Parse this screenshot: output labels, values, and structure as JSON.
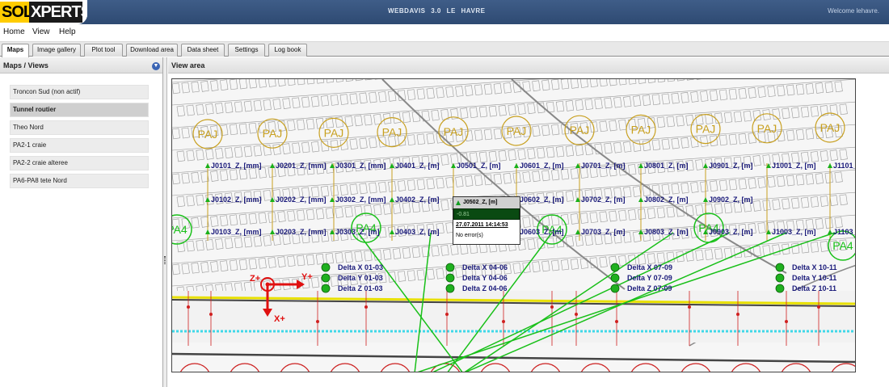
{
  "header": {
    "logo_left": "SOLE",
    "logo_right": "XPERTS",
    "app_title": "WEBDAVIS 3.0 LE HAVRE",
    "welcome": "Welcome lehavre."
  },
  "menu": [
    "Home",
    "View",
    "Help"
  ],
  "tabs": [
    "Maps",
    "Image gallery",
    "Plot tool",
    "Download area",
    "Data sheet",
    "Settings",
    "Log book"
  ],
  "active_tab": "Maps",
  "left_panel": {
    "title": "Maps / Views",
    "items": [
      {
        "label": "Troncon Sud (non actif)",
        "selected": false
      },
      {
        "label": "Tunnel routier",
        "selected": true
      },
      {
        "label": "Theo Nord",
        "selected": false
      },
      {
        "label": "PA2-1 craie",
        "selected": false
      },
      {
        "label": "PA2-2 craie alteree",
        "selected": false
      },
      {
        "label": "PA6-PA8 tete Nord",
        "selected": false
      }
    ]
  },
  "view_area": {
    "title": "View area",
    "pa_markers": [
      "PAJ",
      "PAJ",
      "PAJ",
      "PAJ",
      "PAJ",
      "PAJ",
      "PAJ",
      "PAJ",
      "PAJ",
      "PAJ",
      "PAJ"
    ],
    "pa4_markers": [
      "PA4",
      "PA4",
      "PA4",
      "PA4",
      "PA4"
    ],
    "sensors_row1": [
      "J0101_Z, [mm]",
      "J0201_Z, [mm]",
      "J0301_Z, [mm]",
      "J0401_Z, [m]",
      "J0501_Z, [m]",
      "J0601_Z, [m]",
      "J0701_Z, [m]",
      "J0801_Z, [m]",
      "J0901_Z, [m]",
      "J1001_Z, [m]",
      "J1101_Z, [m]"
    ],
    "sensors_row2": [
      "J0102_Z, [mm]",
      "J0202_Z, [mm]",
      "J0302_Z, [mm]",
      "J0402_Z, [m]",
      "J0602_Z, [m]",
      "J0702_Z, [m]",
      "J0802_Z, [m]",
      "J0902_Z, [m]"
    ],
    "sensors_row3": [
      "J0103_Z, [mm]",
      "J0203_Z, [mm]",
      "J0303_Z, [m]",
      "J0403_Z, [m]",
      "J0603_Z, [m]",
      "J0703_Z, [m]",
      "J0803_Z, [m]",
      "J0903_Z, [m]",
      "J1003_Z, [m]",
      "J1103_Z, [m]"
    ],
    "delta_groups": [
      [
        "Delta X 01-03",
        "Delta Y 01-03",
        "Delta Z 01-03"
      ],
      [
        "Delta X 04-06",
        "Delta Y 04-06",
        "Delta Z 04-06"
      ],
      [
        "Delta X 07-09",
        "Delta Y 07-09",
        "Delta Z 07-09"
      ],
      [
        "Delta X 10-11",
        "Delta Y 10-11",
        "Delta Z 10-11"
      ]
    ],
    "axes": {
      "z": "Z+",
      "y": "Y+",
      "x": "X+"
    },
    "tooltip": {
      "title": "J0502_Z, [m]",
      "value": "-0.81",
      "date": "27.07.2011 14:14:53",
      "status": "No error(s)"
    }
  },
  "colors": {
    "header_bg": "#34527c",
    "logo_yellow": "#ffcc00",
    "sensor_text": "#1a1a7a",
    "sensor_marker": "#19b019",
    "pa_color": "#c8a020",
    "pa4_color": "#19c019",
    "axis_red": "#e01010"
  }
}
